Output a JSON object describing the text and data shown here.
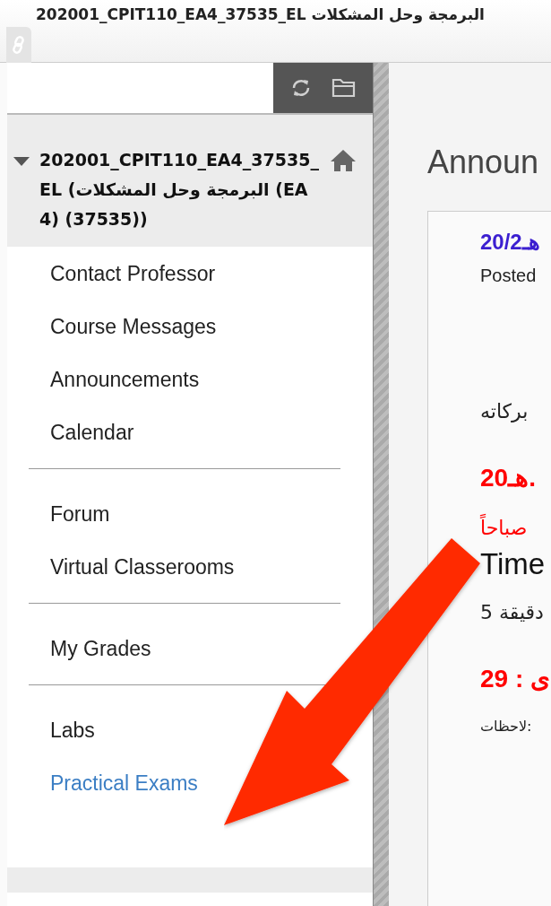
{
  "page_title": "202001_CPIT110_EA4_37535_EL البرمجة وحل المشكلات",
  "course": {
    "title": "202001_CPIT110_EA4_37535_EL (البرمجة وحل المشكلات (EA4) (37535))",
    "expanded": true
  },
  "menu_groups": [
    {
      "items": [
        {
          "label": "Contact Professor",
          "selected": false
        },
        {
          "label": "Course Messages",
          "selected": false
        },
        {
          "label": "Announcements",
          "selected": false
        },
        {
          "label": "Calendar",
          "selected": false
        }
      ]
    },
    {
      "items": [
        {
          "label": "Forum",
          "selected": false
        },
        {
          "label": "Virtual Classerooms",
          "selected": false
        }
      ]
    },
    {
      "items": [
        {
          "label": "My Grades",
          "selected": false
        }
      ]
    },
    {
      "items": [
        {
          "label": "Labs",
          "selected": false
        },
        {
          "label": "Practical Exams",
          "selected": true
        }
      ]
    }
  ],
  "content": {
    "heading": "Announ",
    "lines": [
      {
        "text": "هـ20/2",
        "kind": "date"
      },
      {
        "text": "Posted",
        "kind": "meta"
      },
      {
        "text": "بركاته",
        "kind": "body"
      },
      {
        "text": "20هـ.",
        "kind": "alert"
      },
      {
        "text": "صباحاً",
        "kind": "note"
      },
      {
        "text": "Time",
        "kind": "large"
      },
      {
        "text": "دقيقة 5",
        "kind": "body"
      },
      {
        "text": "ى : 29",
        "kind": "alert"
      },
      {
        "text": "لاحظات:",
        "kind": "small"
      }
    ]
  }
}
